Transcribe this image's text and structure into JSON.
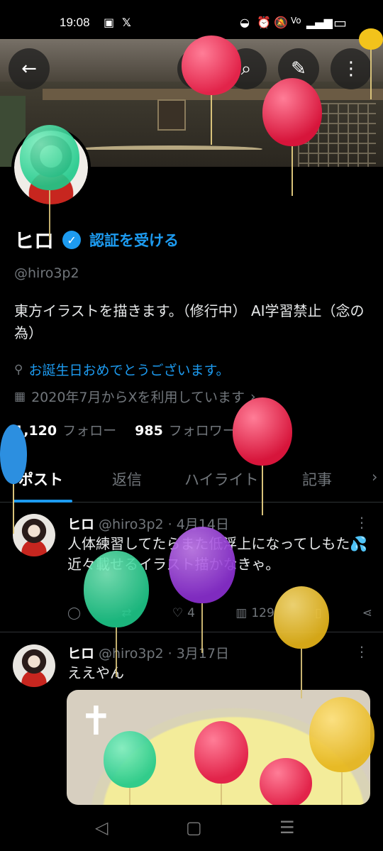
{
  "status_bar": {
    "time": "19:08"
  },
  "profile": {
    "name": "ヒロ",
    "verify_link": "認証を受ける",
    "handle": "@hiro3p2",
    "bio": "東方イラストを描きます。（修行中） AI学習禁止（念の為）",
    "location": "お誕生日おめでとうございます。",
    "joined": "2020年7月からXを利用しています",
    "following_count": "1,120",
    "following_label": "フォロー",
    "followers_count": "985",
    "followers_label": "フォロワー"
  },
  "tabs": [
    {
      "label": "ポスト",
      "active": true
    },
    {
      "label": "返信",
      "active": false
    },
    {
      "label": "ハイライト",
      "active": false
    },
    {
      "label": "記事",
      "active": false
    }
  ],
  "posts": [
    {
      "name": "ヒロ",
      "handle": "@hiro3p2",
      "date": "· 4月14日",
      "text": "人体練習してたらまた低浮上になってしもた💦\n近々載せるイラスト描かなきゃ。",
      "likes": "4",
      "views": "129"
    },
    {
      "name": "ヒロ",
      "handle": "@hiro3p2",
      "date": "· 3月17日",
      "text": "ええやん"
    }
  ],
  "colors": {
    "accent": "#1d9bf0",
    "background": "#000000",
    "muted": "#71767b"
  }
}
